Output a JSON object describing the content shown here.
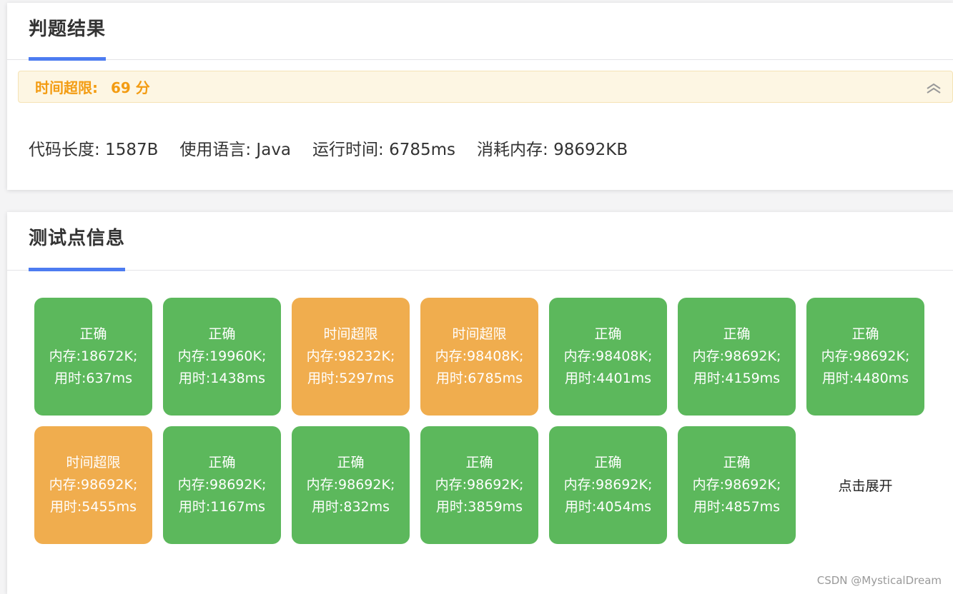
{
  "result": {
    "title": "判题结果",
    "status_label": "时间超限:",
    "score": "69 分",
    "code_length": "代码长度: 1587B",
    "language": "使用语言: Java",
    "run_time": "运行时间: 6785ms",
    "memory": "消耗内存: 98692KB",
    "collapse_icon": "chevron-double-up-icon"
  },
  "tests": {
    "title": "测试点信息",
    "expand_label": "点击展开",
    "items": [
      {
        "status": "正确",
        "memory": "内存:18672K;",
        "time": "用时:637ms",
        "kind": "ok"
      },
      {
        "status": "正确",
        "memory": "内存:19960K;",
        "time": "用时:1438ms",
        "kind": "ok"
      },
      {
        "status": "时间超限",
        "memory": "内存:98232K;",
        "time": "用时:5297ms",
        "kind": "tle"
      },
      {
        "status": "时间超限",
        "memory": "内存:98408K;",
        "time": "用时:6785ms",
        "kind": "tle"
      },
      {
        "status": "正确",
        "memory": "内存:98408K;",
        "time": "用时:4401ms",
        "kind": "ok"
      },
      {
        "status": "正确",
        "memory": "内存:98692K;",
        "time": "用时:4159ms",
        "kind": "ok"
      },
      {
        "status": "正确",
        "memory": "内存:98692K;",
        "time": "用时:4480ms",
        "kind": "ok"
      },
      {
        "status": "时间超限",
        "memory": "内存:98692K;",
        "time": "用时:5455ms",
        "kind": "tle"
      },
      {
        "status": "正确",
        "memory": "内存:98692K;",
        "time": "用时:1167ms",
        "kind": "ok"
      },
      {
        "status": "正确",
        "memory": "内存:98692K;",
        "time": "用时:832ms",
        "kind": "ok"
      },
      {
        "status": "正确",
        "memory": "内存:98692K;",
        "time": "用时:3859ms",
        "kind": "ok"
      },
      {
        "status": "正确",
        "memory": "内存:98692K;",
        "time": "用时:4054ms",
        "kind": "ok"
      },
      {
        "status": "正确",
        "memory": "内存:98692K;",
        "time": "用时:4857ms",
        "kind": "ok"
      }
    ]
  },
  "colors": {
    "accepted": "#5cb85c",
    "time_limit": "#f0ad4e",
    "accent": "#4d7cf1",
    "warning_text": "#f39c12"
  },
  "watermark": "CSDN @MysticalDream"
}
